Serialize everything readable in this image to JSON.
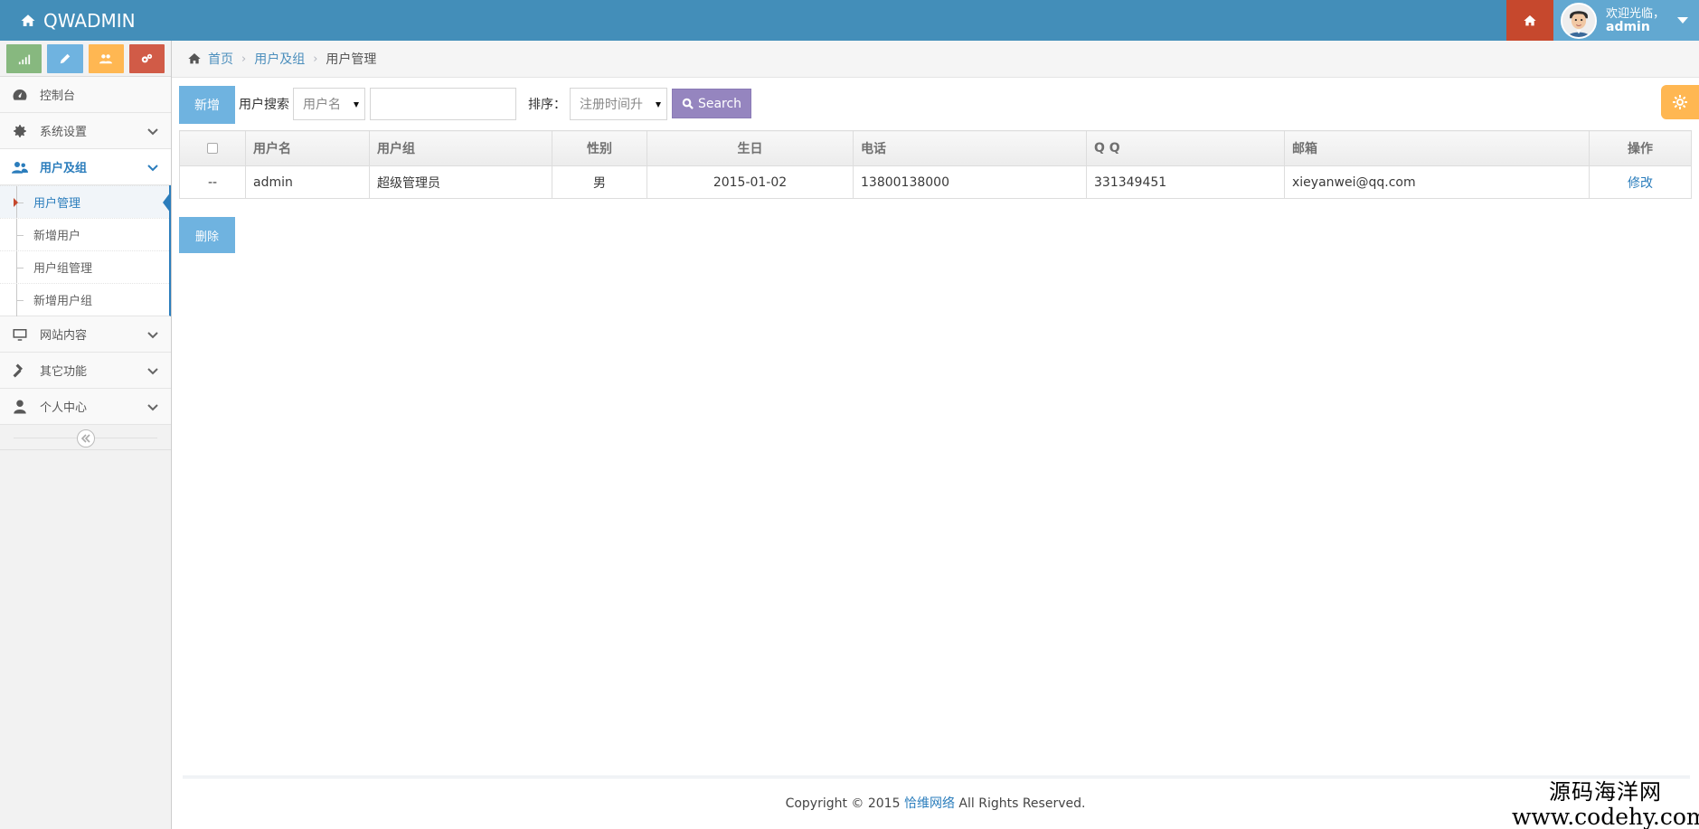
{
  "navbar": {
    "brand": "QWADMIN",
    "welcome": "欢迎光临，",
    "username": "admin"
  },
  "sidebar": {
    "menu": {
      "dashboard": "控制台",
      "system": "系统设置",
      "users": "用户及组",
      "content": "网站内容",
      "other": "其它功能",
      "personal": "个人中心"
    },
    "submenu": {
      "user_manage": "用户管理",
      "add_user": "新增用户",
      "group_manage": "用户组管理",
      "add_group": "新增用户组"
    }
  },
  "breadcrumb": {
    "home": "首页",
    "section": "用户及组",
    "current": "用户管理"
  },
  "toolbar": {
    "add_label": "新增",
    "search_label": "用户搜索",
    "field_select": "用户名",
    "search_value": "",
    "sort_label": "排序：",
    "sort_select": "注册时间升",
    "search_button": "Search",
    "delete_label": "删除"
  },
  "table": {
    "headers": {
      "username": "用户名",
      "group": "用户组",
      "gender": "性别",
      "birthday": "生日",
      "phone": "电话",
      "qq": "Q Q",
      "email": "邮箱",
      "action": "操作"
    },
    "rows": [
      {
        "id": "--",
        "username": "admin",
        "group": "超级管理员",
        "gender": "男",
        "birthday": "2015-01-02",
        "phone": "13800138000",
        "qq": "331349451",
        "email": "xieyanwei@qq.com",
        "action": "修改"
      }
    ]
  },
  "footer": {
    "prefix": "Copyright © 2015 ",
    "company": "恰维网络",
    "suffix": " All Rights Reserved."
  },
  "watermark": {
    "line1": "源码海洋网",
    "line2": "www.codehy.com"
  },
  "colors": {
    "navbar": "#438eb9",
    "home_button": "#c6482d",
    "user_area": "#62a8d1",
    "accent": "#2b7dbc",
    "search_button": "#9585bf",
    "add_button": "#6fb3e0",
    "settings": "#ffb752",
    "shortcut_green": "#87b87f",
    "shortcut_blue": "#6fb3e0",
    "shortcut_orange": "#ffb752",
    "shortcut_red": "#d15b47"
  },
  "icons": {
    "brand": "home-icon",
    "nav_home": "home-icon",
    "dashboard": "tachometer-icon",
    "system": "gear-icon",
    "users": "users-icon",
    "content": "desktop-icon",
    "other": "gavel-icon",
    "personal": "user-icon",
    "search": "search-icon",
    "settings": "cog-icon"
  }
}
